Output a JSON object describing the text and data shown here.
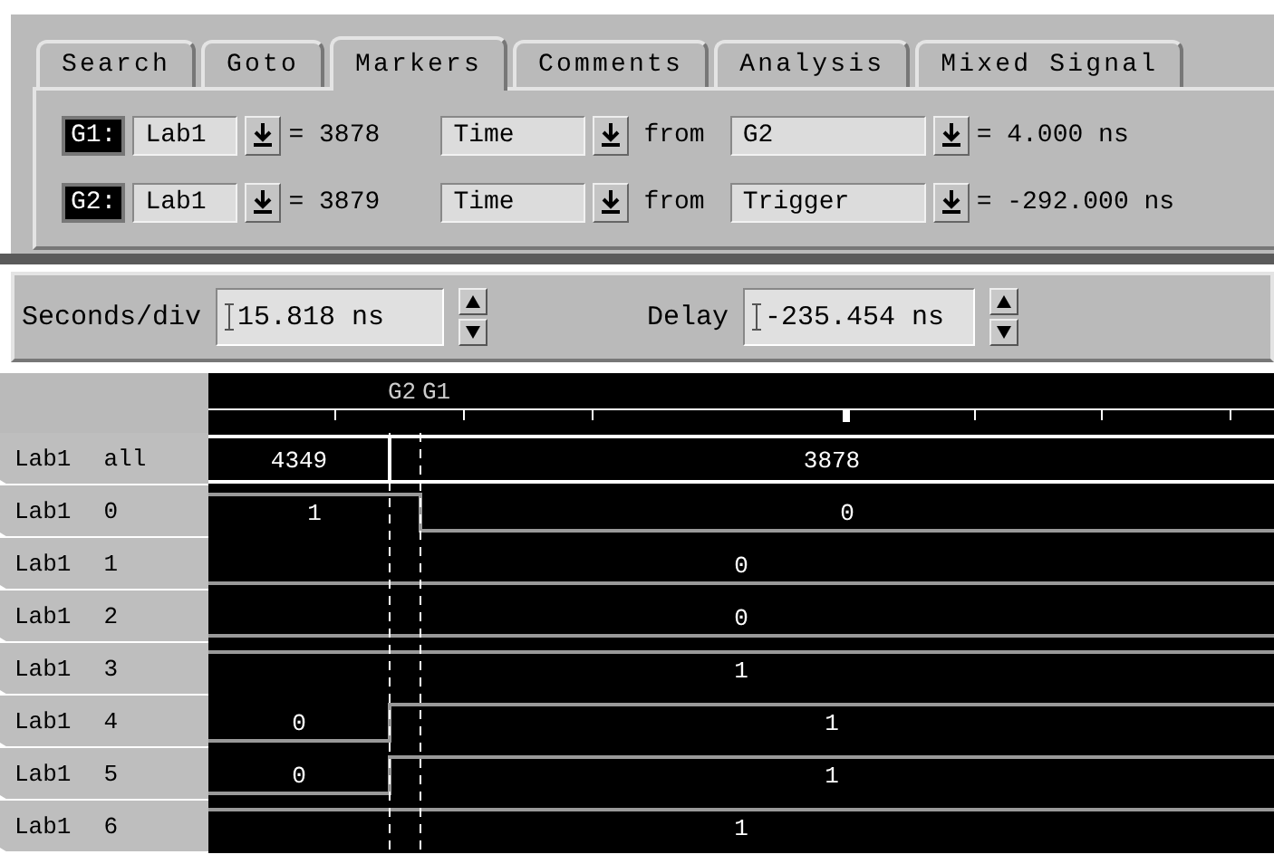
{
  "tabs": [
    {
      "label": "Search",
      "selected": false
    },
    {
      "label": "Goto",
      "selected": false
    },
    {
      "label": "Markers",
      "selected": true
    },
    {
      "label": "Comments",
      "selected": false
    },
    {
      "label": "Analysis",
      "selected": false
    },
    {
      "label": "Mixed Signal",
      "selected": false
    }
  ],
  "markers_panel": [
    {
      "marker": "G1:",
      "label": "Lab1",
      "position": "= 3878",
      "mode": "Time",
      "from_word": "from",
      "reference": "G2",
      "reading": "= 4.000 ns"
    },
    {
      "marker": "G2:",
      "label": "Lab1",
      "position": "= 3879",
      "mode": "Time",
      "from_word": "from",
      "reference": "Trigger",
      "reading": "= -292.000 ns"
    }
  ],
  "timebase": {
    "seconds_label": "Seconds/div",
    "seconds_value": "15.818 ns",
    "delay_label": "Delay",
    "delay_value": "-235.454 ns"
  },
  "waveform": {
    "markers": [
      {
        "label": "G2"
      },
      {
        "label": "G1"
      }
    ],
    "rows": [
      {
        "label": "Lab1",
        "bit": "all",
        "kind": "bus",
        "segments": [
          {
            "text": "4349",
            "kind": "before_g2"
          },
          {
            "text": "3878",
            "kind": "rest"
          }
        ]
      },
      {
        "label": "Lab1",
        "bit": "0",
        "kind": "bit",
        "segments": [
          {
            "text": "1",
            "high": true,
            "kind": "before_g1"
          },
          {
            "text": "0",
            "high": false,
            "kind": "rest"
          }
        ]
      },
      {
        "label": "Lab1",
        "bit": "1",
        "kind": "bit",
        "segments": [
          {
            "text": "0",
            "high": false,
            "kind": "rest"
          }
        ]
      },
      {
        "label": "Lab1",
        "bit": "2",
        "kind": "bit",
        "segments": [
          {
            "text": "0",
            "high": false,
            "kind": "rest"
          }
        ]
      },
      {
        "label": "Lab1",
        "bit": "3",
        "kind": "bit",
        "segments": [
          {
            "text": "1",
            "high": true,
            "kind": "rest"
          }
        ]
      },
      {
        "label": "Lab1",
        "bit": "4",
        "kind": "bit",
        "segments": [
          {
            "text": "0",
            "high": false,
            "kind": "before_g2"
          },
          {
            "text": "1",
            "high": true,
            "kind": "rest"
          }
        ]
      },
      {
        "label": "Lab1",
        "bit": "5",
        "kind": "bit",
        "segments": [
          {
            "text": "0",
            "high": false,
            "kind": "before_g2"
          },
          {
            "text": "1",
            "high": true,
            "kind": "rest"
          }
        ]
      },
      {
        "label": "Lab1",
        "bit": "6",
        "kind": "bit",
        "segments": [
          {
            "text": "1",
            "high": true,
            "kind": "rest"
          }
        ]
      }
    ]
  }
}
